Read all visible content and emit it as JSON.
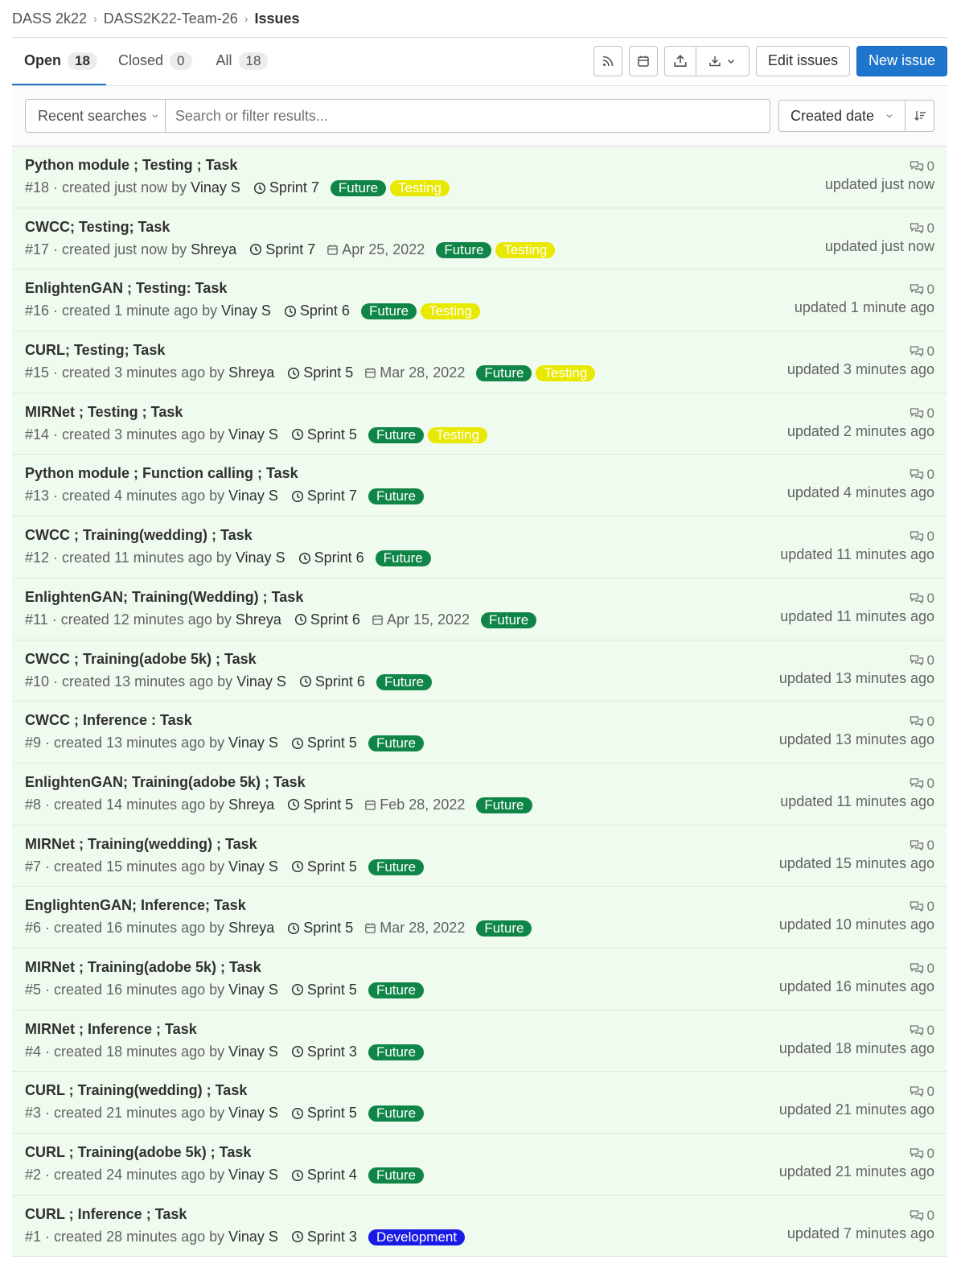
{
  "breadcrumb": {
    "group": "DASS 2k22",
    "project": "DASS2K22-Team-26",
    "current": "Issues"
  },
  "tabs": [
    {
      "label": "Open",
      "count": "18"
    },
    {
      "label": "Closed",
      "count": "0"
    },
    {
      "label": "All",
      "count": "18"
    }
  ],
  "toolbar": {
    "edit_label": "Edit issues",
    "new_label": "New issue"
  },
  "filter": {
    "recent_label": "Recent searches",
    "placeholder": "Search or filter results...",
    "sort_label": "Created date"
  },
  "colors": {
    "future": "#108548",
    "testing": "#e8e800",
    "development": "#1a1ae6",
    "primary": "#1f75cb"
  },
  "issues": [
    {
      "title": "Python module ; Testing ; Task",
      "ref": "#18",
      "created": "created just now by",
      "author": "Vinay S",
      "milestone": "Sprint 7",
      "due": "",
      "labels": [
        {
          "text": "Future",
          "color": "#108548"
        },
        {
          "text": "Testing",
          "color": "#e8e800"
        }
      ],
      "comments": "0",
      "updated": "updated just now"
    },
    {
      "title": "CWCC; Testing; Task",
      "ref": "#17",
      "created": "created just now by",
      "author": "Shreya",
      "milestone": "Sprint 7",
      "due": "Apr 25, 2022",
      "labels": [
        {
          "text": "Future",
          "color": "#108548"
        },
        {
          "text": "Testing",
          "color": "#e8e800"
        }
      ],
      "comments": "0",
      "updated": "updated just now"
    },
    {
      "title": "EnlightenGAN ; Testing: Task",
      "ref": "#16",
      "created": "created 1 minute ago by",
      "author": "Vinay S",
      "milestone": "Sprint 6",
      "due": "",
      "labels": [
        {
          "text": "Future",
          "color": "#108548"
        },
        {
          "text": "Testing",
          "color": "#e8e800"
        }
      ],
      "comments": "0",
      "updated": "updated 1 minute ago"
    },
    {
      "title": "CURL; Testing; Task",
      "ref": "#15",
      "created": "created 3 minutes ago by",
      "author": "Shreya",
      "milestone": "Sprint 5",
      "due": "Mar 28, 2022",
      "labels": [
        {
          "text": "Future",
          "color": "#108548"
        },
        {
          "text": "Testing",
          "color": "#e8e800"
        }
      ],
      "comments": "0",
      "updated": "updated 3 minutes ago"
    },
    {
      "title": "MIRNet ; Testing ; Task",
      "ref": "#14",
      "created": "created 3 minutes ago by",
      "author": "Vinay S",
      "milestone": "Sprint 5",
      "due": "",
      "labels": [
        {
          "text": "Future",
          "color": "#108548"
        },
        {
          "text": "Testing",
          "color": "#e8e800"
        }
      ],
      "comments": "0",
      "updated": "updated 2 minutes ago"
    },
    {
      "title": "Python module ; Function calling ; Task",
      "ref": "#13",
      "created": "created 4 minutes ago by",
      "author": "Vinay S",
      "milestone": "Sprint 7",
      "due": "",
      "labels": [
        {
          "text": "Future",
          "color": "#108548"
        }
      ],
      "comments": "0",
      "updated": "updated 4 minutes ago"
    },
    {
      "title": "CWCC ; Training(wedding) ; Task",
      "ref": "#12",
      "created": "created 11 minutes ago by",
      "author": "Vinay S",
      "milestone": "Sprint 6",
      "due": "",
      "labels": [
        {
          "text": "Future",
          "color": "#108548"
        }
      ],
      "comments": "0",
      "updated": "updated 11 minutes ago"
    },
    {
      "title": "EnlightenGAN; Training(Wedding) ; Task",
      "ref": "#11",
      "created": "created 12 minutes ago by",
      "author": "Shreya",
      "milestone": "Sprint 6",
      "due": "Apr 15, 2022",
      "labels": [
        {
          "text": "Future",
          "color": "#108548"
        }
      ],
      "comments": "0",
      "updated": "updated 11 minutes ago"
    },
    {
      "title": "CWCC ; Training(adobe 5k) ; Task",
      "ref": "#10",
      "created": "created 13 minutes ago by",
      "author": "Vinay S",
      "milestone": "Sprint 6",
      "due": "",
      "labels": [
        {
          "text": "Future",
          "color": "#108548"
        }
      ],
      "comments": "0",
      "updated": "updated 13 minutes ago"
    },
    {
      "title": "CWCC ; Inference : Task",
      "ref": "#9",
      "created": "created 13 minutes ago by",
      "author": "Vinay S",
      "milestone": "Sprint 5",
      "due": "",
      "labels": [
        {
          "text": "Future",
          "color": "#108548"
        }
      ],
      "comments": "0",
      "updated": "updated 13 minutes ago"
    },
    {
      "title": "EnlightenGAN; Training(adobe 5k) ; Task",
      "ref": "#8",
      "created": "created 14 minutes ago by",
      "author": "Shreya",
      "milestone": "Sprint 5",
      "due": "Feb 28, 2022",
      "labels": [
        {
          "text": "Future",
          "color": "#108548"
        }
      ],
      "comments": "0",
      "updated": "updated 11 minutes ago"
    },
    {
      "title": "MIRNet ; Training(wedding) ; Task",
      "ref": "#7",
      "created": "created 15 minutes ago by",
      "author": "Vinay S",
      "milestone": "Sprint 5",
      "due": "",
      "labels": [
        {
          "text": "Future",
          "color": "#108548"
        }
      ],
      "comments": "0",
      "updated": "updated 15 minutes ago"
    },
    {
      "title": "EnglightenGAN; Inference; Task",
      "ref": "#6",
      "created": "created 16 minutes ago by",
      "author": "Shreya",
      "milestone": "Sprint 5",
      "due": "Mar 28, 2022",
      "labels": [
        {
          "text": "Future",
          "color": "#108548"
        }
      ],
      "comments": "0",
      "updated": "updated 10 minutes ago"
    },
    {
      "title": "MIRNet ; Training(adobe 5k) ; Task",
      "ref": "#5",
      "created": "created 16 minutes ago by",
      "author": "Vinay S",
      "milestone": "Sprint 5",
      "due": "",
      "labels": [
        {
          "text": "Future",
          "color": "#108548"
        }
      ],
      "comments": "0",
      "updated": "updated 16 minutes ago"
    },
    {
      "title": "MIRNet ; Inference ; Task",
      "ref": "#4",
      "created": "created 18 minutes ago by",
      "author": "Vinay S",
      "milestone": "Sprint 3",
      "due": "",
      "labels": [
        {
          "text": "Future",
          "color": "#108548"
        }
      ],
      "comments": "0",
      "updated": "updated 18 minutes ago"
    },
    {
      "title": "CURL ; Training(wedding) ; Task",
      "ref": "#3",
      "created": "created 21 minutes ago by",
      "author": "Vinay S",
      "milestone": "Sprint 5",
      "due": "",
      "labels": [
        {
          "text": "Future",
          "color": "#108548"
        }
      ],
      "comments": "0",
      "updated": "updated 21 minutes ago"
    },
    {
      "title": "CURL ; Training(adobe 5k) ; Task",
      "ref": "#2",
      "created": "created 24 minutes ago by",
      "author": "Vinay S",
      "milestone": "Sprint 4",
      "due": "",
      "labels": [
        {
          "text": "Future",
          "color": "#108548"
        }
      ],
      "comments": "0",
      "updated": "updated 21 minutes ago"
    },
    {
      "title": "CURL ; Inference ; Task",
      "ref": "#1",
      "created": "created 28 minutes ago by",
      "author": "Vinay S",
      "milestone": "Sprint 3",
      "due": "",
      "labels": [
        {
          "text": "Development",
          "color": "#1a1ae6"
        }
      ],
      "comments": "0",
      "updated": "updated 7 minutes ago"
    }
  ]
}
